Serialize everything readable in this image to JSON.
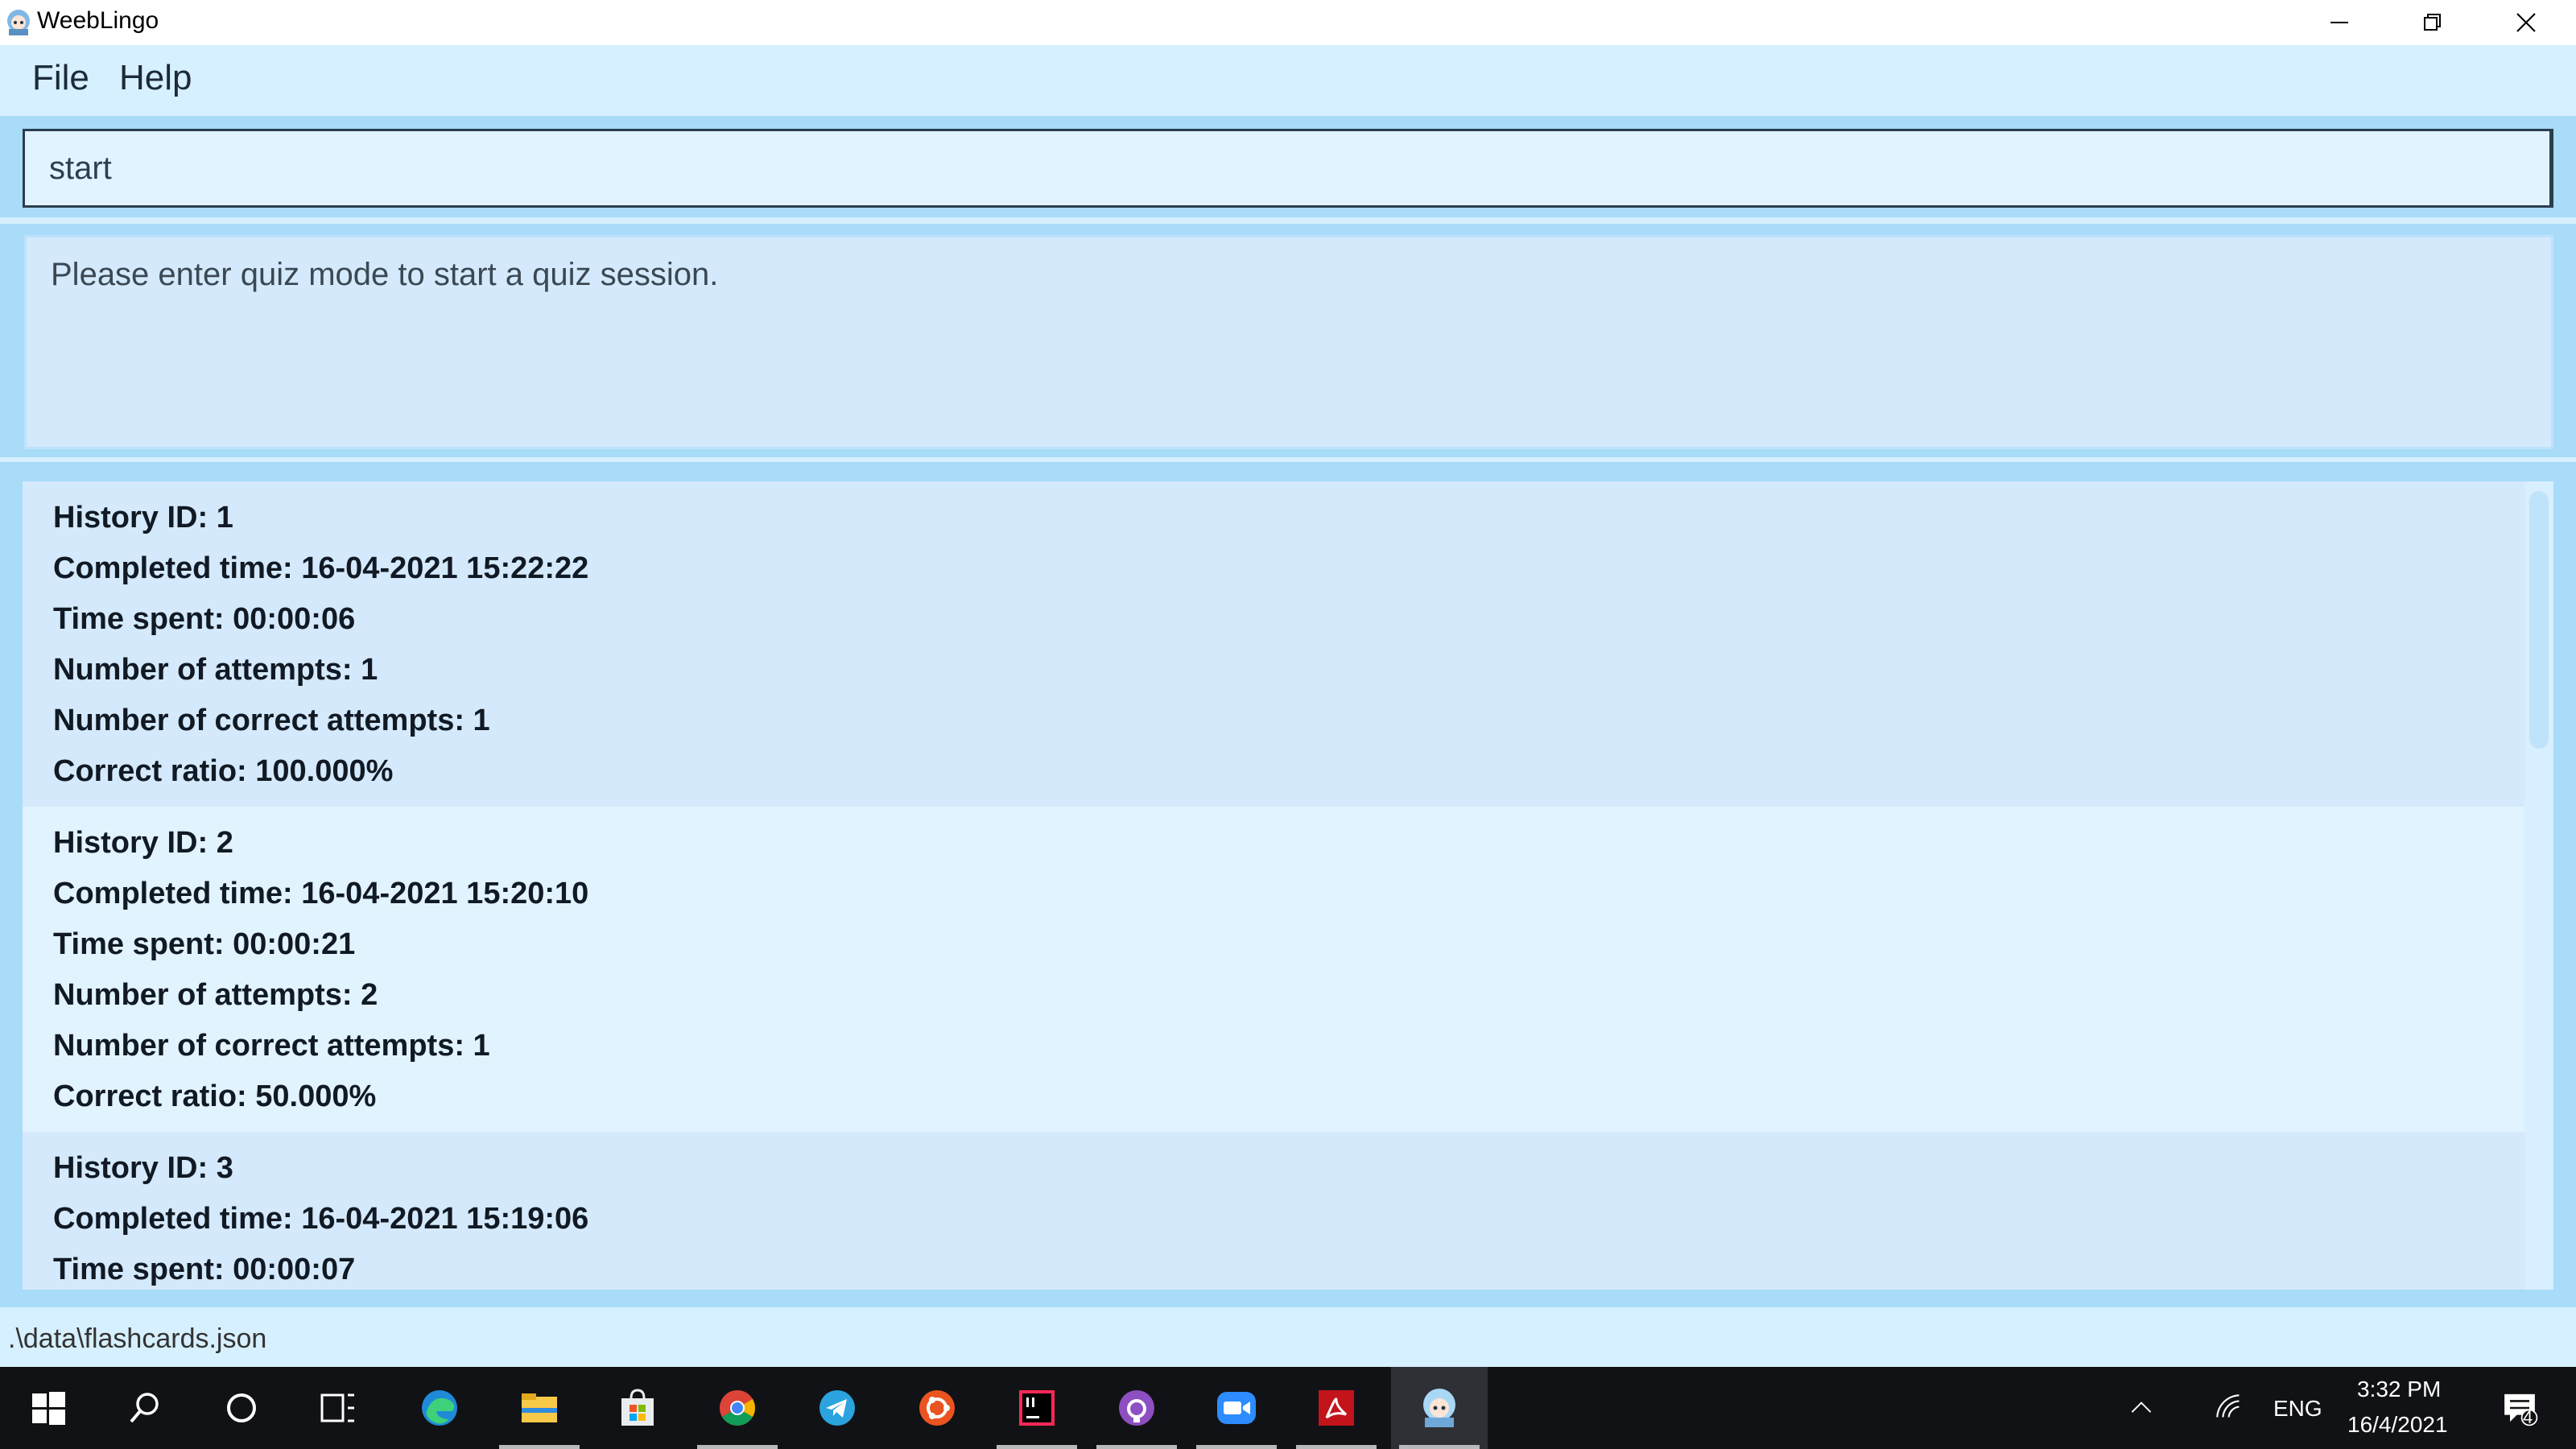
{
  "window": {
    "title": "WeebLingo"
  },
  "menu": {
    "file": "File",
    "help": "Help"
  },
  "command": {
    "value": "start"
  },
  "result": {
    "message": "Please enter quiz mode to start a quiz session."
  },
  "history": [
    {
      "id": "History ID: 1",
      "completed": "Completed time: 16-04-2021 15:22:22",
      "spent": "Time spent: 00:00:06",
      "attempts": "Number of attempts: 1",
      "correct": "Number of correct attempts: 1",
      "ratio": "Correct ratio: 100.000%"
    },
    {
      "id": "History ID: 2",
      "completed": "Completed time: 16-04-2021 15:20:10",
      "spent": "Time spent: 00:00:21",
      "attempts": "Number of attempts: 2",
      "correct": "Number of correct attempts: 1",
      "ratio": "Correct ratio: 50.000%"
    },
    {
      "id": "History ID: 3",
      "completed": "Completed time: 16-04-2021 15:19:06",
      "spent": "Time spent: 00:00:07"
    }
  ],
  "status": {
    "path": ".\\data\\flashcards.json"
  },
  "taskbar": {
    "icons": [
      "windows-start-icon",
      "search-icon",
      "cortana-icon",
      "task-view-icon",
      "edge-icon",
      "file-explorer-icon",
      "store-icon",
      "chrome-icon",
      "telegram-icon",
      "ubuntu-icon",
      "intellij-icon",
      "github-icon",
      "zoom-icon",
      "acrobat-icon",
      "weeblingo-icon"
    ],
    "language": "ENG",
    "time": "3:32 PM",
    "date": "16/4/2021",
    "notifications": "4"
  }
}
